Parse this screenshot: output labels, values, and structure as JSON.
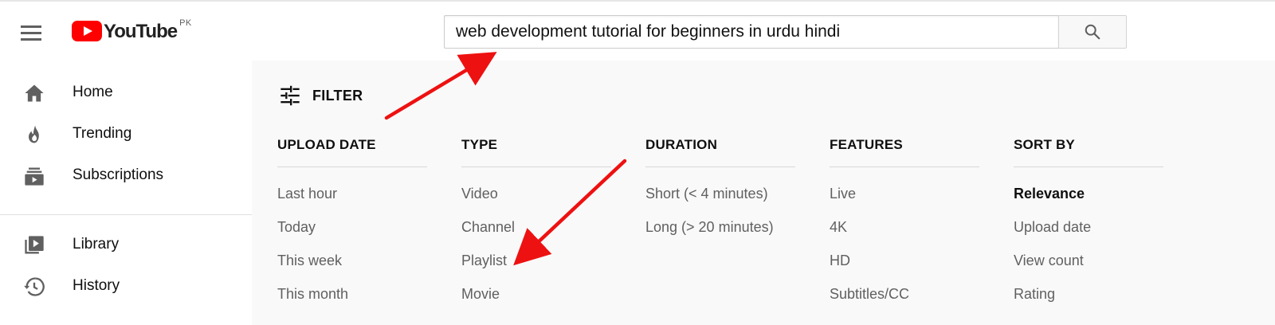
{
  "masthead": {
    "logo_text": "YouTube",
    "country_code": "PK",
    "search_query": "web development tutorial for beginners in urdu hindi"
  },
  "sidebar": {
    "items": [
      {
        "label": "Home",
        "icon": "home-icon"
      },
      {
        "label": "Trending",
        "icon": "trending-icon"
      },
      {
        "label": "Subscriptions",
        "icon": "subscriptions-icon"
      },
      {
        "label": "Library",
        "icon": "library-icon"
      },
      {
        "label": "History",
        "icon": "history-icon"
      }
    ]
  },
  "filters": {
    "toggle_label": "FILTER",
    "columns": [
      {
        "header": "UPLOAD DATE",
        "options": [
          "Last hour",
          "Today",
          "This week",
          "This month"
        ]
      },
      {
        "header": "TYPE",
        "options": [
          "Video",
          "Channel",
          "Playlist",
          "Movie"
        ]
      },
      {
        "header": "DURATION",
        "options": [
          "Short (< 4 minutes)",
          "Long (> 20 minutes)"
        ]
      },
      {
        "header": "FEATURES",
        "options": [
          "Live",
          "4K",
          "HD",
          "Subtitles/CC"
        ]
      },
      {
        "header": "SORT BY",
        "options": [
          "Relevance",
          "Upload date",
          "View count",
          "Rating"
        ],
        "selected": "Relevance"
      }
    ]
  },
  "colors": {
    "brand_red": "#ff0000",
    "annotation_arrow": "#ee1111",
    "panel_bg": "#f9f9f9",
    "option_text": "#606060"
  }
}
